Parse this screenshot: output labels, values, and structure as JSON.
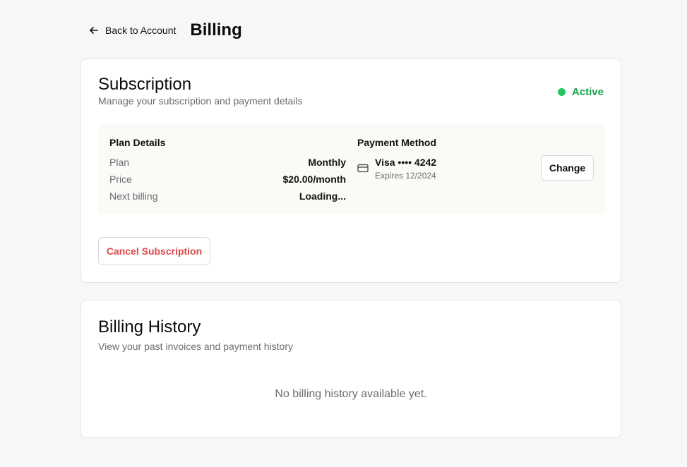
{
  "header": {
    "back_label": "Back to Account",
    "title": "Billing"
  },
  "subscription": {
    "title": "Subscription",
    "description": "Manage your subscription and payment details",
    "status": "Active",
    "status_color": "#16a34a",
    "plan_details": {
      "title": "Plan Details",
      "rows": [
        {
          "label": "Plan",
          "value": "Monthly"
        },
        {
          "label": "Price",
          "value": "$20.00/month"
        },
        {
          "label": "Next billing",
          "value": "Loading..."
        }
      ]
    },
    "payment_method": {
      "title": "Payment Method",
      "card": "Visa •••• 4242",
      "expires": "Expires 12/2024",
      "change_label": "Change"
    },
    "cancel_label": "Cancel Subscription",
    "cancel_color": "#dc4a4a"
  },
  "billing_history": {
    "title": "Billing History",
    "description": "View your past invoices and payment history",
    "empty_message": "No billing history available yet."
  },
  "icons": {
    "back": "arrow-left-icon",
    "card": "credit-card-icon"
  }
}
